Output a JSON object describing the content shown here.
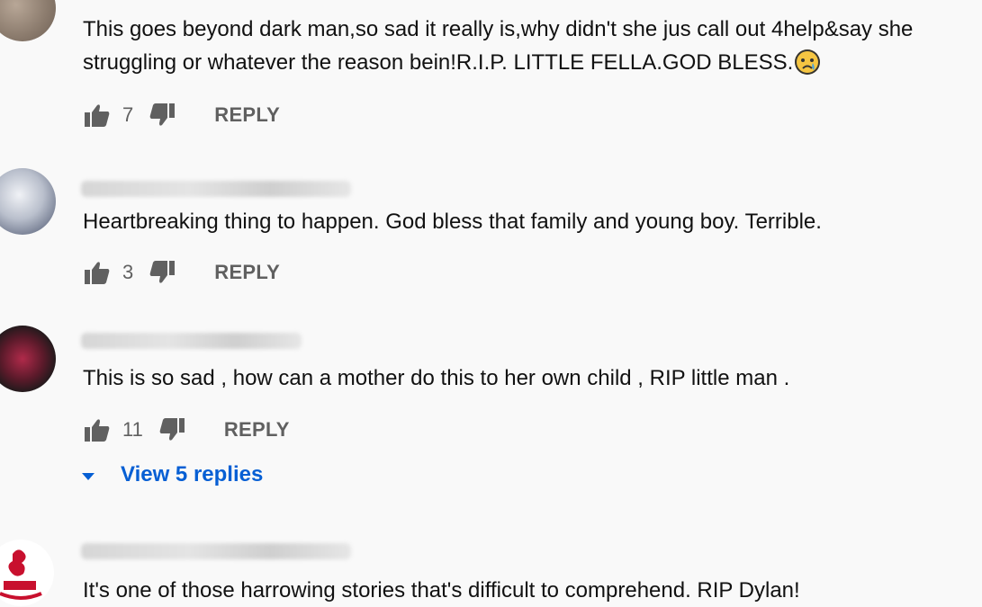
{
  "comments": [
    {
      "text_line1": "This goes beyond dark man,so sad it really is,why didn't she jus call out 4help&say she",
      "text_line2": "struggling or whatever the reason bein!R.I.P. LITTLE FELLA.GOD BLESS.",
      "likes": "7",
      "reply_label": "REPLY"
    },
    {
      "text": "Heartbreaking thing to happen. God bless that family and young boy. Terrible.",
      "likes": "3",
      "reply_label": "REPLY"
    },
    {
      "text": "This is so sad , how can a mother do this to her own child , RIP little man .",
      "likes": "11",
      "reply_label": "REPLY",
      "view_replies": "View 5 replies"
    },
    {
      "text": "It's one of those harrowing stories that's difficult to comprehend. RIP Dylan!"
    }
  ],
  "colors": {
    "link": "#065fd4",
    "meta": "#606060",
    "background": "#f9f9f9"
  },
  "icons": [
    "thumb-up-icon",
    "thumb-down-icon",
    "caret-down-icon",
    "sad-emoji-icon"
  ]
}
